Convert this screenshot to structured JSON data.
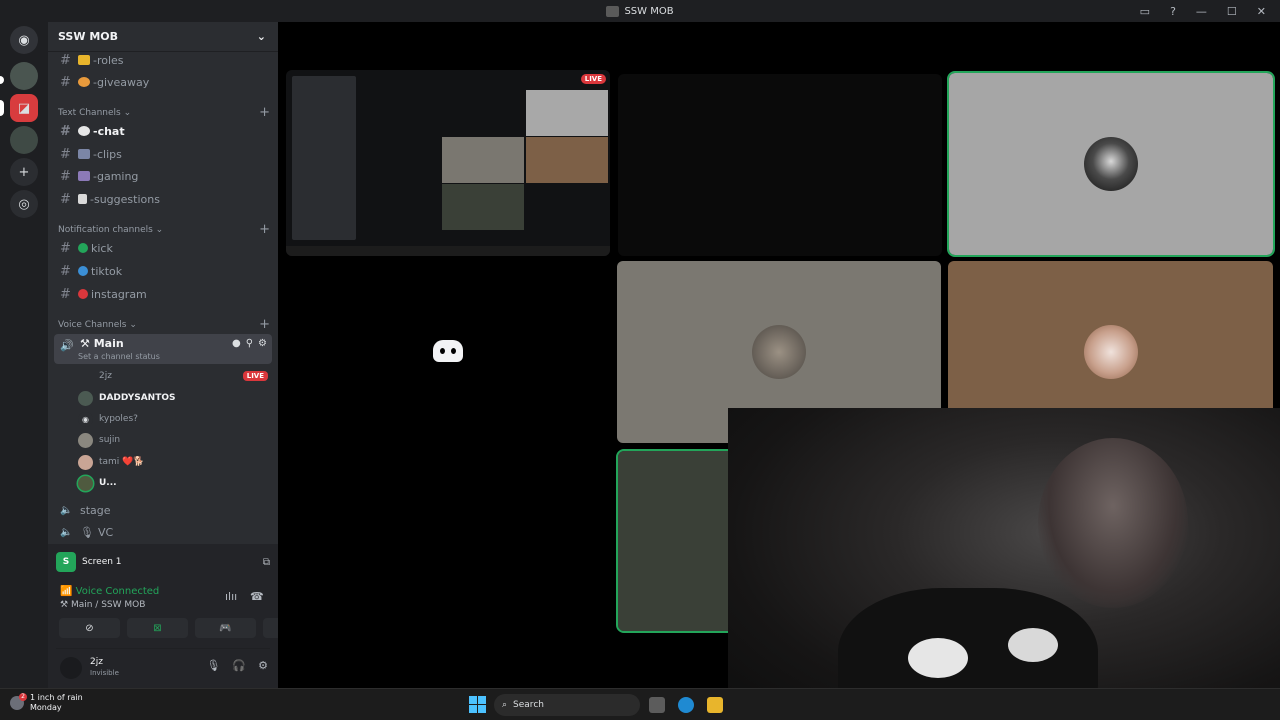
{
  "window": {
    "title": "SSW MOB"
  },
  "guild": {
    "name": "SSW MOB",
    "top_channels": [
      {
        "name": "-roles",
        "icon": "folder-icon"
      },
      {
        "name": "-giveaway",
        "icon": "party-icon"
      }
    ],
    "categories": {
      "text": "Text Channels",
      "notification": "Notification channels",
      "voice": "Voice Channels"
    },
    "text_channels": [
      {
        "name": "-chat",
        "icon": "speech-bubble-icon"
      },
      {
        "name": "-clips",
        "icon": "film-icon"
      },
      {
        "name": "-gaming",
        "icon": "gamepad-icon"
      },
      {
        "name": "-suggestions",
        "icon": "memo-icon"
      }
    ],
    "notification_channels": [
      {
        "name": "kick",
        "icon": "green-circle-icon"
      },
      {
        "name": "tiktok",
        "icon": "blue-circle-icon"
      },
      {
        "name": "instagram",
        "icon": "red-circle-icon"
      }
    ],
    "voice_main": {
      "name": "Main",
      "status": "Set a channel status"
    },
    "voice_members": [
      {
        "name": "2jz",
        "live": "LIVE"
      },
      {
        "name": "DADDYSANTOS"
      },
      {
        "name": "kypoles?"
      },
      {
        "name": "sujin"
      },
      {
        "name": "tami ❤️🐕"
      },
      {
        "name": "U..."
      }
    ],
    "other_voice": [
      {
        "name": "stage"
      },
      {
        "name": "VC"
      }
    ]
  },
  "panel": {
    "stream_label": "Screen 1",
    "stream_initial": "S",
    "voice_connected": "Voice Connected",
    "voice_location": "Main / SSW MOB",
    "user": {
      "name": "2jz",
      "status": "Invisible"
    }
  },
  "stage": {
    "live_badge": "LIVE"
  },
  "taskbar": {
    "weather_text": "1 inch of rain",
    "weather_day": "Monday",
    "weather_badge": "2",
    "search_label": "Search"
  },
  "colors": {
    "accent_green": "#23a55a",
    "live_red": "#da373c",
    "sidebar_bg": "#2b2d31",
    "stage_bg": "#000000"
  }
}
